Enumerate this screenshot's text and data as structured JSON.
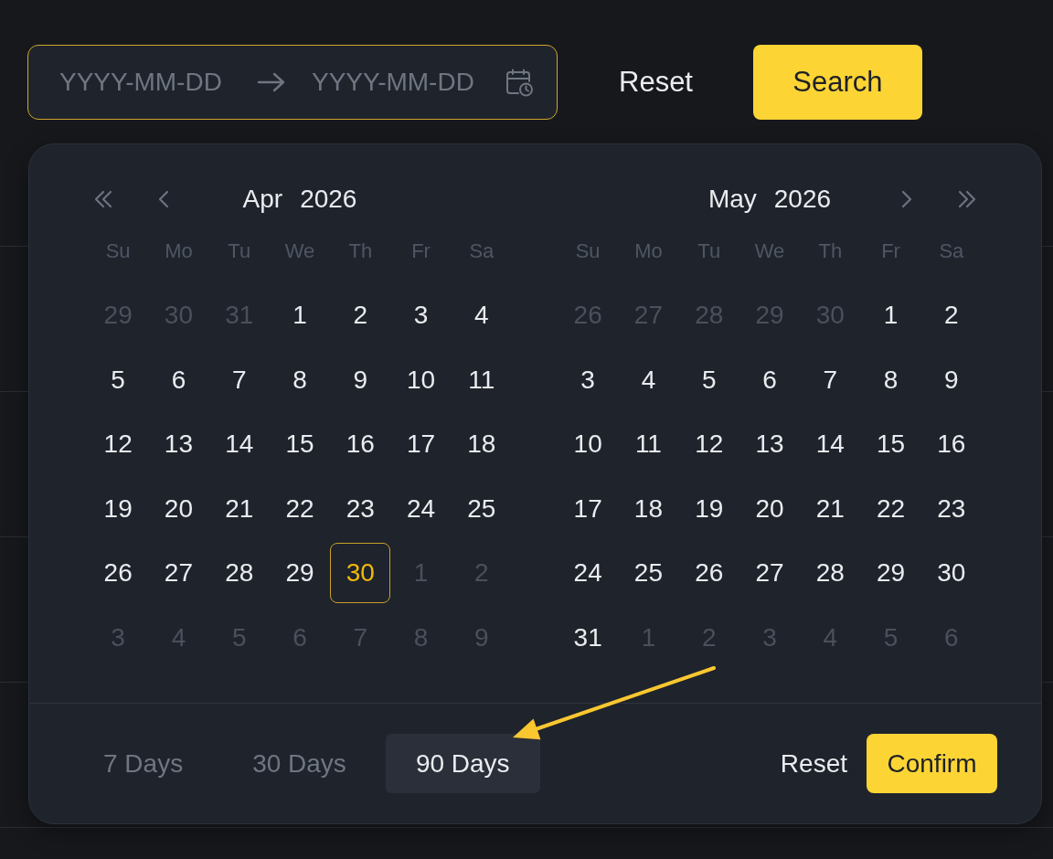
{
  "toolbar": {
    "range_field": {
      "start_placeholder": "YYYY-MM-DD",
      "end_placeholder": "YYYY-MM-DD",
      "focused": true
    },
    "reset_button": {
      "label": "Reset"
    },
    "search_button": {
      "label": "Search"
    }
  },
  "popover": {
    "calendars": [
      {
        "previous_buttons": true,
        "month": "Apr",
        "year": "2026",
        "weekdays": [
          "Su",
          "Mo",
          "Tu",
          "We",
          "Th",
          "Fr",
          "Sa"
        ],
        "weeks": [
          [
            {
              "day": "29",
              "outside_month": true,
              "selected": false
            },
            {
              "day": "30",
              "outside_month": true,
              "selected": false
            },
            {
              "day": "31",
              "outside_month": true,
              "selected": false
            },
            {
              "day": "1",
              "outside_month": false,
              "selected": false
            },
            {
              "day": "2",
              "outside_month": false,
              "selected": false
            },
            {
              "day": "3",
              "outside_month": false,
              "selected": false
            },
            {
              "day": "4",
              "outside_month": false,
              "selected": false
            }
          ],
          [
            {
              "day": "5",
              "outside_month": false,
              "selected": false
            },
            {
              "day": "6",
              "outside_month": false,
              "selected": false
            },
            {
              "day": "7",
              "outside_month": false,
              "selected": false
            },
            {
              "day": "8",
              "outside_month": false,
              "selected": false
            },
            {
              "day": "9",
              "outside_month": false,
              "selected": false
            },
            {
              "day": "10",
              "outside_month": false,
              "selected": false
            },
            {
              "day": "11",
              "outside_month": false,
              "selected": false
            }
          ],
          [
            {
              "day": "12",
              "outside_month": false,
              "selected": false
            },
            {
              "day": "13",
              "outside_month": false,
              "selected": false
            },
            {
              "day": "14",
              "outside_month": false,
              "selected": false
            },
            {
              "day": "15",
              "outside_month": false,
              "selected": false
            },
            {
              "day": "16",
              "outside_month": false,
              "selected": false
            },
            {
              "day": "17",
              "outside_month": false,
              "selected": false
            },
            {
              "day": "18",
              "outside_month": false,
              "selected": false
            }
          ],
          [
            {
              "day": "19",
              "outside_month": false,
              "selected": false
            },
            {
              "day": "20",
              "outside_month": false,
              "selected": false
            },
            {
              "day": "21",
              "outside_month": false,
              "selected": false
            },
            {
              "day": "22",
              "outside_month": false,
              "selected": false
            },
            {
              "day": "23",
              "outside_month": false,
              "selected": false
            },
            {
              "day": "24",
              "outside_month": false,
              "selected": false
            },
            {
              "day": "25",
              "outside_month": false,
              "selected": false
            }
          ],
          [
            {
              "day": "26",
              "outside_month": false,
              "selected": false
            },
            {
              "day": "27",
              "outside_month": false,
              "selected": false
            },
            {
              "day": "28",
              "outside_month": false,
              "selected": false
            },
            {
              "day": "29",
              "outside_month": false,
              "selected": false
            },
            {
              "day": "30",
              "outside_month": false,
              "selected": true
            },
            {
              "day": "1",
              "outside_month": true,
              "selected": false
            },
            {
              "day": "2",
              "outside_month": true,
              "selected": false
            }
          ],
          [
            {
              "day": "3",
              "outside_month": true,
              "selected": false
            },
            {
              "day": "4",
              "outside_month": true,
              "selected": false
            },
            {
              "day": "5",
              "outside_month": true,
              "selected": false
            },
            {
              "day": "6",
              "outside_month": true,
              "selected": false
            },
            {
              "day": "7",
              "outside_month": true,
              "selected": false
            },
            {
              "day": "8",
              "outside_month": true,
              "selected": false
            },
            {
              "day": "9",
              "outside_month": true,
              "selected": false
            }
          ]
        ]
      },
      {
        "next_buttons": true,
        "month": "May",
        "year": "2026",
        "weekdays": [
          "Su",
          "Mo",
          "Tu",
          "We",
          "Th",
          "Fr",
          "Sa"
        ],
        "weeks": [
          [
            {
              "day": "26",
              "outside_month": true,
              "selected": false
            },
            {
              "day": "27",
              "outside_month": true,
              "selected": false
            },
            {
              "day": "28",
              "outside_month": true,
              "selected": false
            },
            {
              "day": "29",
              "outside_month": true,
              "selected": false
            },
            {
              "day": "30",
              "outside_month": true,
              "selected": false
            },
            {
              "day": "1",
              "outside_month": false,
              "selected": false
            },
            {
              "day": "2",
              "outside_month": false,
              "selected": false
            }
          ],
          [
            {
              "day": "3",
              "outside_month": false,
              "selected": false
            },
            {
              "day": "4",
              "outside_month": false,
              "selected": false
            },
            {
              "day": "5",
              "outside_month": false,
              "selected": false
            },
            {
              "day": "6",
              "outside_month": false,
              "selected": false
            },
            {
              "day": "7",
              "outside_month": false,
              "selected": false
            },
            {
              "day": "8",
              "outside_month": false,
              "selected": false
            },
            {
              "day": "9",
              "outside_month": false,
              "selected": false
            }
          ],
          [
            {
              "day": "10",
              "outside_month": false,
              "selected": false
            },
            {
              "day": "11",
              "outside_month": false,
              "selected": false
            },
            {
              "day": "12",
              "outside_month": false,
              "selected": false
            },
            {
              "day": "13",
              "outside_month": false,
              "selected": false
            },
            {
              "day": "14",
              "outside_month": false,
              "selected": false
            },
            {
              "day": "15",
              "outside_month": false,
              "selected": false
            },
            {
              "day": "16",
              "outside_month": false,
              "selected": false
            }
          ],
          [
            {
              "day": "17",
              "outside_month": false,
              "selected": false
            },
            {
              "day": "18",
              "outside_month": false,
              "selected": false
            },
            {
              "day": "19",
              "outside_month": false,
              "selected": false
            },
            {
              "day": "20",
              "outside_month": false,
              "selected": false
            },
            {
              "day": "21",
              "outside_month": false,
              "selected": false
            },
            {
              "day": "22",
              "outside_month": false,
              "selected": false
            },
            {
              "day": "23",
              "outside_month": false,
              "selected": false
            }
          ],
          [
            {
              "day": "24",
              "outside_month": false,
              "selected": false
            },
            {
              "day": "25",
              "outside_month": false,
              "selected": false
            },
            {
              "day": "26",
              "outside_month": false,
              "selected": false
            },
            {
              "day": "27",
              "outside_month": false,
              "selected": false
            },
            {
              "day": "28",
              "outside_month": false,
              "selected": false
            },
            {
              "day": "29",
              "outside_month": false,
              "selected": false
            },
            {
              "day": "30",
              "outside_month": false,
              "selected": false
            }
          ],
          [
            {
              "day": "31",
              "outside_month": false,
              "selected": false
            },
            {
              "day": "1",
              "outside_month": true,
              "selected": false
            },
            {
              "day": "2",
              "outside_month": true,
              "selected": false
            },
            {
              "day": "3",
              "outside_month": true,
              "selected": false
            },
            {
              "day": "4",
              "outside_month": true,
              "selected": false
            },
            {
              "day": "5",
              "outside_month": true,
              "selected": false
            },
            {
              "day": "6",
              "outside_month": true,
              "selected": false
            }
          ]
        ]
      }
    ],
    "presets": [
      {
        "label": "7 Days",
        "selected": false
      },
      {
        "label": "30 Days",
        "selected": false
      },
      {
        "label": "90 Days",
        "selected": true
      }
    ],
    "reset_button": {
      "label": "Reset"
    },
    "confirm_button": {
      "label": "Confirm"
    }
  }
}
